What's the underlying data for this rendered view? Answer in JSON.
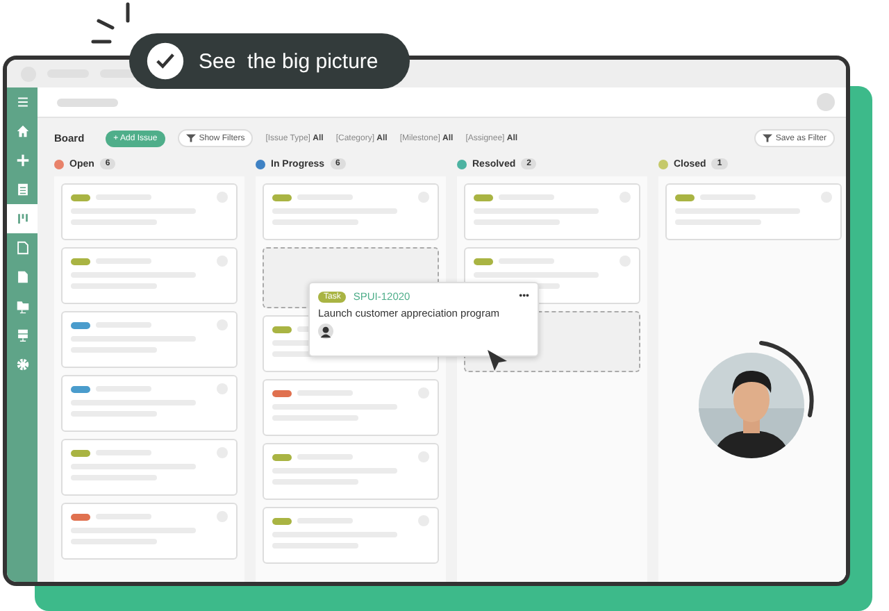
{
  "callout": {
    "text": "See  the big picture"
  },
  "sidebar": {
    "items": [
      {
        "kind": "menu",
        "selected": false
      },
      {
        "kind": "home",
        "selected": false
      },
      {
        "kind": "plus",
        "selected": false
      },
      {
        "kind": "list",
        "selected": false
      },
      {
        "kind": "board",
        "selected": true
      },
      {
        "kind": "document",
        "selected": false
      },
      {
        "kind": "file",
        "selected": false
      },
      {
        "kind": "folder",
        "selected": false
      },
      {
        "kind": "stack",
        "selected": false
      },
      {
        "kind": "gear",
        "selected": false
      }
    ]
  },
  "toolbar": {
    "title": "Board",
    "add_button": "+ Add Issue",
    "filter_button": "Show Filters",
    "save_button": "Save as Filter",
    "filters": [
      {
        "label": "[Issue Type]",
        "value": "All"
      },
      {
        "label": "[Category]",
        "value": "All"
      },
      {
        "label": "[Milestone]",
        "value": "All"
      },
      {
        "label": "[Assignee]",
        "value": "All"
      }
    ]
  },
  "columns": [
    {
      "name": "Open",
      "count": "6",
      "color": "#e8826a",
      "cards": [
        {
          "kind": "card",
          "color": "#a9b443"
        },
        {
          "kind": "card",
          "color": "#a9b443"
        },
        {
          "kind": "card",
          "color": "#4a9ccc"
        },
        {
          "kind": "card",
          "color": "#4a9ccc"
        },
        {
          "kind": "card",
          "color": "#a9b443"
        },
        {
          "kind": "card",
          "color": "#e0714f"
        }
      ]
    },
    {
      "name": "In Progress",
      "count": "6",
      "color": "#3f82c4",
      "cards": [
        {
          "kind": "card",
          "color": "#a9b443"
        },
        {
          "kind": "placeholder"
        },
        {
          "kind": "card",
          "color": "#a9b443"
        },
        {
          "kind": "card",
          "color": "#e0714f"
        },
        {
          "kind": "card",
          "color": "#a9b443"
        },
        {
          "kind": "card",
          "color": "#a9b443"
        }
      ]
    },
    {
      "name": "Resolved",
      "count": "2",
      "color": "#4db3a2",
      "cards": [
        {
          "kind": "card",
          "color": "#a9b443"
        },
        {
          "kind": "card",
          "color": "#a9b443"
        },
        {
          "kind": "placeholder"
        }
      ]
    },
    {
      "name": "Closed",
      "count": "1",
      "color": "#c5c96a",
      "cards": [
        {
          "kind": "card",
          "color": "#a9b443"
        }
      ]
    }
  ],
  "dragged_card": {
    "tag": "Task",
    "key": "SPUI-12020",
    "title": "Launch customer appreciation program",
    "more": "•••"
  }
}
